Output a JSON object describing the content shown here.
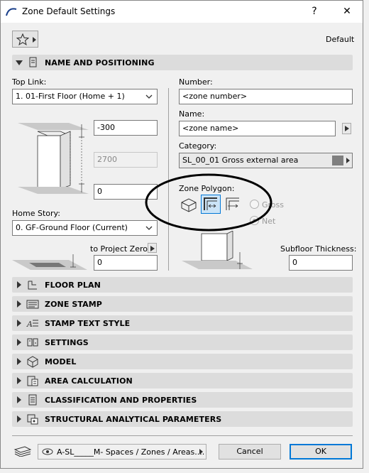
{
  "window": {
    "title": "Zone Default Settings",
    "help": "?",
    "close": "✕"
  },
  "header": {
    "preset_label": "Default"
  },
  "sections": {
    "name_positioning": "NAME AND POSITIONING",
    "collapsed": [
      "FLOOR PLAN",
      "ZONE STAMP",
      "STAMP TEXT STYLE",
      "SETTINGS",
      "MODEL",
      "AREA CALCULATION",
      "CLASSIFICATION AND PROPERTIES",
      "STRUCTURAL ANALYTICAL PARAMETERS"
    ]
  },
  "left": {
    "top_link_label": "Top Link:",
    "top_link_value": "1. 01-First Floor (Home + 1)",
    "top_offset": "-300",
    "height": "2700",
    "bottom_offset": "0",
    "home_story_label": "Home Story:",
    "home_story_value": "0. GF-Ground Floor (Current)",
    "to_project_zero_label": "to Project Zero",
    "project_zero_value": "0"
  },
  "right": {
    "number_label": "Number:",
    "number_value": "<zone number>",
    "name_label": "Name:",
    "name_value": "<zone name>",
    "category_label": "Category:",
    "category_value": "SL_00_01   Gross external area",
    "category_color": "#808080",
    "zone_polygon_label": "Zone Polygon:",
    "gross_label": "Gross",
    "net_label": "Net",
    "subfloor_label": "Subfloor Thickness:",
    "subfloor_value": "0"
  },
  "footer": {
    "layer_value": "A-SL_____M- Spaces / Zones / Areas....",
    "cancel": "Cancel",
    "ok": "OK"
  }
}
